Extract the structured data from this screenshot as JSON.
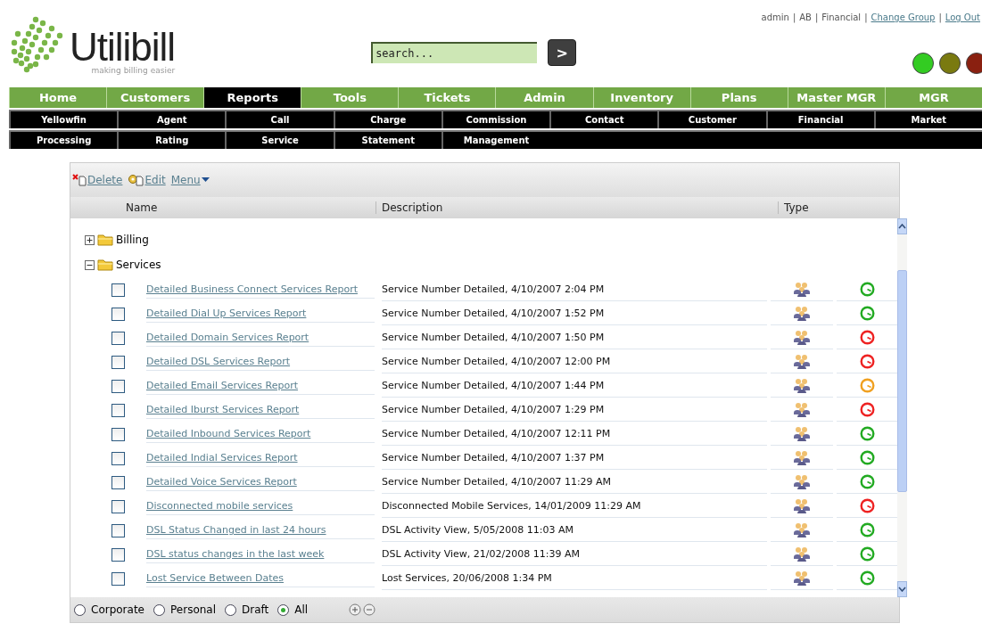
{
  "header": {
    "logo_text": "Utilibill",
    "tagline": "making billing easier",
    "search": {
      "placeholder": "search..."
    },
    "search_button": ">",
    "user_links": [
      {
        "text": "admin",
        "kind": "text"
      },
      {
        "text": "|",
        "kind": "separator"
      },
      {
        "text": "AB",
        "kind": "text"
      },
      {
        "text": "|",
        "kind": "separator"
      },
      {
        "text": "Financial",
        "kind": "text"
      },
      {
        "text": "|",
        "kind": "separator"
      },
      {
        "text": "Change Group",
        "kind": "link"
      },
      {
        "text": "|",
        "kind": "separator"
      },
      {
        "text": "Log Out",
        "kind": "link"
      }
    ],
    "status_lights": [
      {
        "color": "#33cc22"
      },
      {
        "color": "#7a7a10"
      },
      {
        "color": "#8a2010"
      }
    ]
  },
  "main_nav": [
    {
      "label": "Home",
      "selected": false
    },
    {
      "label": "Customers",
      "selected": false
    },
    {
      "label": "Reports",
      "selected": true
    },
    {
      "label": "Tools",
      "selected": false
    },
    {
      "label": "Tickets",
      "selected": false
    },
    {
      "label": "Admin",
      "selected": false
    },
    {
      "label": "Inventory",
      "selected": false
    },
    {
      "label": "Plans",
      "selected": false
    },
    {
      "label": "Master MGR",
      "selected": false
    },
    {
      "label": "MGR",
      "selected": false
    }
  ],
  "sub_nav": [
    [
      "Yellowfin",
      "Agent",
      "Call",
      "Charge",
      "Commission",
      "Contact",
      "Customer",
      "Financial",
      "Market"
    ],
    [
      "Processing",
      "Rating",
      "Service",
      "Statement",
      "Management"
    ]
  ],
  "toolbar": [
    {
      "label": "Delete",
      "kind": "delete"
    },
    {
      "label": "Edit",
      "kind": "edit"
    },
    {
      "label": "Menu",
      "kind": "menu"
    }
  ],
  "table": {
    "columns": [
      "Name",
      "Description",
      "Type"
    ],
    "folders": [
      {
        "name": "Billing",
        "expanded": false
      },
      {
        "name": "Services",
        "expanded": true,
        "children": [
          {
            "name": "Detailed Business Connect Services Report",
            "description": "Service Number Detailed, 4/10/2007 2:04 PM",
            "checked": false,
            "color": "#22aa22"
          },
          {
            "name": "Detailed Dial Up Services Report",
            "description": "Service Number Detailed, 4/10/2007 1:52 PM",
            "checked": false,
            "color": "#22aa22"
          },
          {
            "name": "Detailed Domain Services Report",
            "description": "Service Number Detailed, 4/10/2007 1:50 PM",
            "checked": false,
            "color": "#ee2222"
          },
          {
            "name": "Detailed DSL Services Report",
            "description": "Service Number Detailed, 4/10/2007 12:00 PM",
            "checked": false,
            "color": "#ee2222"
          },
          {
            "name": "Detailed Email Services Report",
            "description": "Service Number Detailed, 4/10/2007 1:44 PM",
            "checked": false,
            "color": "#f0a020"
          },
          {
            "name": "Detailed Iburst Services Report",
            "description": "Service Number Detailed, 4/10/2007 1:29 PM",
            "checked": false,
            "color": "#ee2222"
          },
          {
            "name": "Detailed Inbound Services Report",
            "description": "Service Number Detailed, 4/10/2007 12:11 PM",
            "checked": false,
            "color": "#22aa22"
          },
          {
            "name": "Detailed Indial Services Report",
            "description": "Service Number Detailed, 4/10/2007 1:37 PM",
            "checked": false,
            "color": "#22aa22"
          },
          {
            "name": "Detailed Voice Services Report",
            "description": "Service Number Detailed, 4/10/2007 11:29 AM",
            "checked": false,
            "color": "#22aa22"
          },
          {
            "name": "Disconnected mobile services",
            "description": "Disconnected Mobile Services, 14/01/2009 11:29 AM",
            "checked": false,
            "color": "#ee2222"
          },
          {
            "name": "DSL Status Changed in last 24 hours",
            "description": "DSL Activity View, 5/05/2008 11:03 AM",
            "checked": false,
            "color": "#22aa22"
          },
          {
            "name": "DSL status changes in the last week",
            "description": "DSL Activity View, 21/02/2008 11:39 AM",
            "checked": false,
            "color": "#22aa22"
          },
          {
            "name": "Lost Service Between Dates",
            "description": "Lost Services, 20/06/2008 1:34 PM",
            "checked": false,
            "color": "#22aa22"
          }
        ]
      }
    ]
  },
  "filters": [
    {
      "label": "Corporate",
      "selected": false
    },
    {
      "label": "Personal",
      "selected": false
    },
    {
      "label": "Draft",
      "selected": false
    },
    {
      "label": "All",
      "selected": true
    }
  ]
}
